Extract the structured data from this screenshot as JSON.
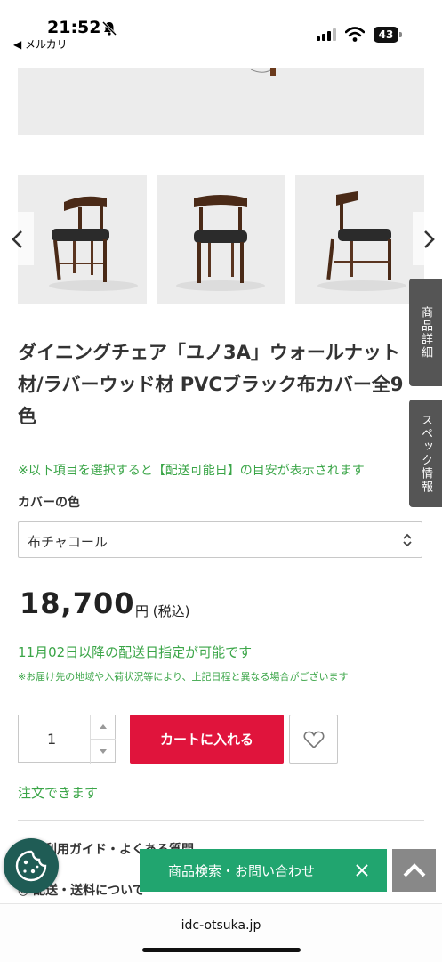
{
  "status_bar": {
    "time": "21:52",
    "back_app": "◀ メルカリ",
    "battery": "43"
  },
  "thumbnails": [
    {
      "name": "chair-front-left-view"
    },
    {
      "name": "chair-front-view"
    },
    {
      "name": "chair-side-view"
    }
  ],
  "side_tabs": {
    "detail": "商品詳細",
    "spec": "スペック情報"
  },
  "product": {
    "title": "ダイニングチェア「ユノ3A」ウォールナット材/ラバーウッド材 PVCブラック布カバー全9色",
    "select_note": "※以下項目を選択すると【配送可能日】の目安が表示されます",
    "color_label": "カバーの色",
    "color_selected": "布チャコール",
    "price": "18,700",
    "price_unit": "円 (税込)",
    "delivery_note": "11月02日以降の配送日指定が可能です",
    "delivery_sub": "※お届け先の地域や入荷状況等により、上記日程と異なる場合がございます",
    "quantity": "1",
    "cart_button": "カートに入れる",
    "order_ok": "注文できます"
  },
  "links": {
    "guide": "利用ガイド・よくある質問",
    "shipping": "◎ 配送・送料について"
  },
  "floating": {
    "search_bar": "商品検索・お問い合わせ"
  },
  "browser": {
    "address": "idc-otsuka.jp"
  },
  "colors": {
    "accent_green": "#3aa547",
    "cart_red": "#e0143c",
    "search_green": "#21a56f",
    "side_tab_gray": "#555555"
  }
}
